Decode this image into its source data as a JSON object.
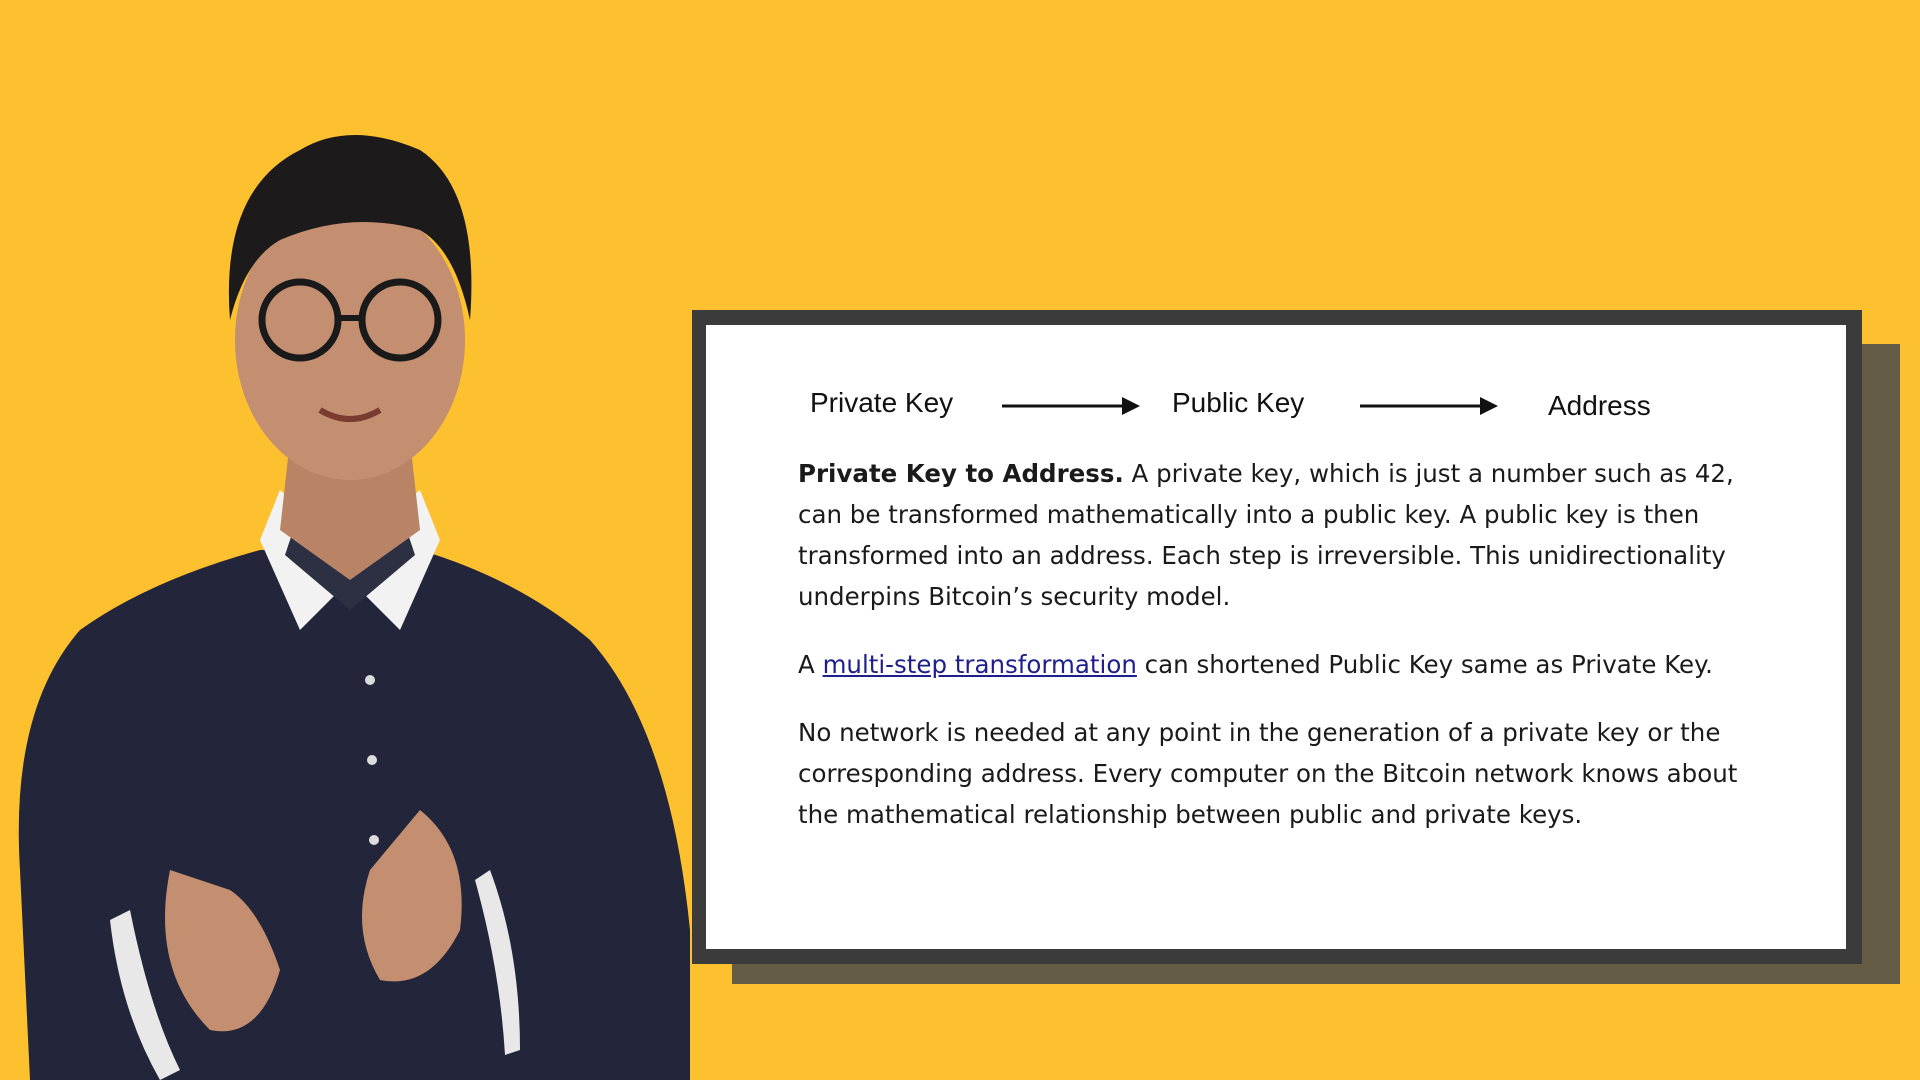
{
  "flow": {
    "nodes": [
      "Private Key",
      "Public Key",
      "Address"
    ]
  },
  "paragraphs": {
    "p1_bold": "Private Key to Address.",
    "p1_text": " A private key, which is just a number such as 42, can be transformed mathematically into a public key. A public key is then transformed into an address. Each step is irreversible. This unidirectionality underpins Bitcoin’s security model.",
    "p2_prefix": "A ",
    "p2_link": "multi-step transformation",
    "p2_suffix": " can shortened Public Key same as Private Key.",
    "p3_text": "No network is needed at any point in the generation of a private key or the corresponding address. Every computer on the Bitcoin network knows about the mathematical relationship between public and private keys."
  },
  "colors": {
    "background": "#FDC12F",
    "slide_frame": "#3b3b3b",
    "link": "#1f1f8c"
  },
  "icons": {
    "arrow": "right-arrow-icon"
  }
}
